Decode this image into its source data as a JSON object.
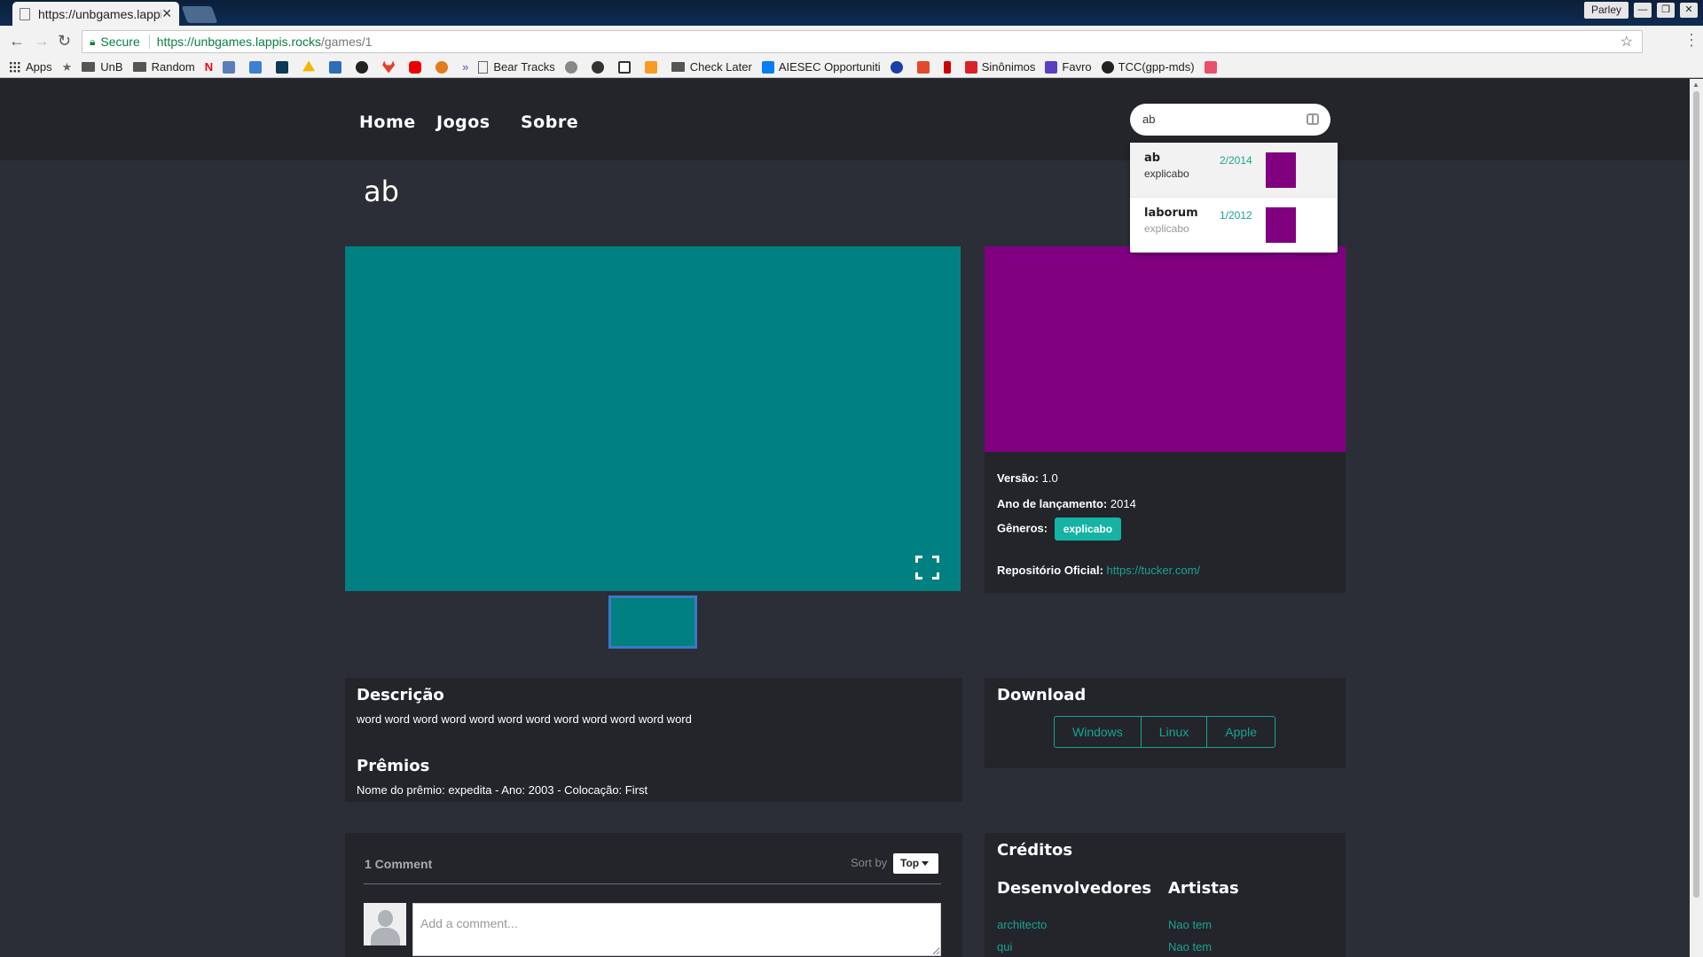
{
  "browser": {
    "tab_title": "https://unbgames.lappis",
    "profile": "Parley",
    "secure_label": "Secure",
    "url_host": "https://unbgames.lappis.rocks",
    "url_path": "/games/1",
    "bookmarks": [
      "Apps",
      "UnB",
      "Random",
      "Bear Tracks",
      "Check Later",
      "AIESEC Opportuniti",
      "Sinônimos",
      "Favro",
      "TCC(gpp-mds)"
    ]
  },
  "nav": {
    "home": "Home",
    "games": "Jogos",
    "about": "Sobre"
  },
  "search": {
    "value": "ab",
    "suggestions": [
      {
        "name": "ab",
        "genre": "explicabo",
        "date": "2/2014"
      },
      {
        "name": "laborum",
        "genre": "explicabo",
        "date": "1/2012"
      }
    ]
  },
  "game": {
    "title": "ab",
    "version_label": "Versão:",
    "version": "1.0",
    "year_label": "Ano de lançamento:",
    "year": "2014",
    "genres_label": "Gêneros:",
    "genre": "explicabo",
    "repo_label": "Repositório Oficial:",
    "repo": "https://tucker.com/"
  },
  "description": {
    "title": "Descrição",
    "text": "word word word word word word word word word word word word",
    "awards_title": "Prêmios",
    "awards_text": "Nome do prêmio: expedita - Ano: 2003 - Colocação: First"
  },
  "download": {
    "title": "Download",
    "windows": "Windows",
    "linux": "Linux",
    "apple": "Apple"
  },
  "comments": {
    "count": "1 Comment",
    "sort_label": "Sort by",
    "sort_value": "Top",
    "placeholder": "Add a comment..."
  },
  "credits": {
    "title": "Créditos",
    "devs_title": "Desenvolvedores",
    "artists_title": "Artistas",
    "devs": [
      "architecto",
      "qui"
    ],
    "artists": [
      "Nao tem",
      "Nao tem"
    ]
  },
  "colors": {
    "teal": "#008080",
    "purple": "#800080",
    "accent": "#1aa392",
    "background": "#2b2e37",
    "panel": "#23252b"
  }
}
